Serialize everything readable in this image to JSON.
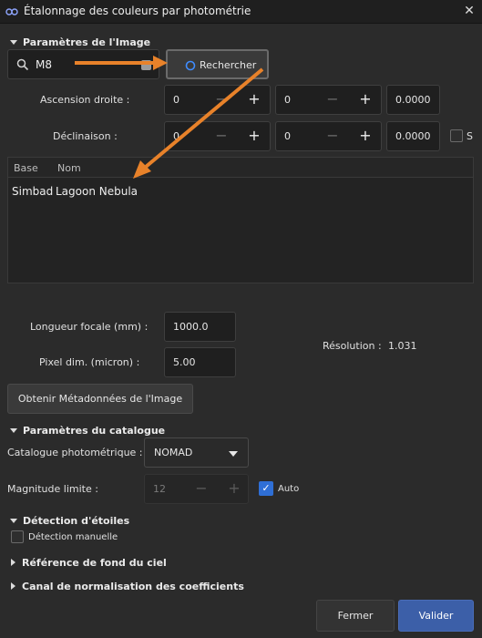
{
  "window": {
    "title": "Étalonnage des couleurs par photométrie",
    "close_glyph": "✕"
  },
  "image_params": {
    "header": "Paramètres de l'Image",
    "search_value": "M8",
    "search_button": "Rechercher",
    "ra_label": "Ascension droite :",
    "ra_h": "0",
    "ra_m": "0",
    "ra_s": "0.0000",
    "dec_label": "Déclinaison :",
    "dec_d": "0",
    "dec_m": "0",
    "dec_s": "0.0000",
    "dec_s_flag": "S",
    "table_headers": [
      "Base",
      "Nom"
    ],
    "table_rows": [
      {
        "base": "Simbad",
        "nom": "Lagoon Nebula"
      }
    ],
    "focal_label": "Longueur focale (mm) :",
    "focal_value": "1000.0",
    "pixel_label": "Pixel dim. (micron) :",
    "pixel_value": "5.00",
    "resolution_label": "Résolution :",
    "resolution_value": "1.031",
    "metadata_button": "Obtenir Métadonnées de l'Image"
  },
  "catalogue_params": {
    "header": "Paramètres du catalogue",
    "catalogue_label": "Catalogue photométrique :",
    "catalogue_value": "NOMAD",
    "mag_label": "Magnitude limite :",
    "mag_value": "12",
    "auto_label": "Auto",
    "auto_checked": true
  },
  "star_detection": {
    "header": "Détection d'étoiles",
    "manual_label": "Détection manuelle",
    "manual_checked": false
  },
  "sky_background": {
    "header": "Référence de fond du ciel"
  },
  "normalization": {
    "header": "Canal de normalisation des coefficients"
  },
  "buttons": {
    "close": "Fermer",
    "validate": "Valider"
  },
  "colors": {
    "accent": "#2f6fd6",
    "arrow": "#e8822a",
    "validate_bg": "#3c5fa8"
  },
  "icons": [
    "app-icon",
    "close-icon",
    "search-icon",
    "clear-icon",
    "refresh-icon",
    "dropdown-arrow-icon",
    "checkmark-icon"
  ]
}
